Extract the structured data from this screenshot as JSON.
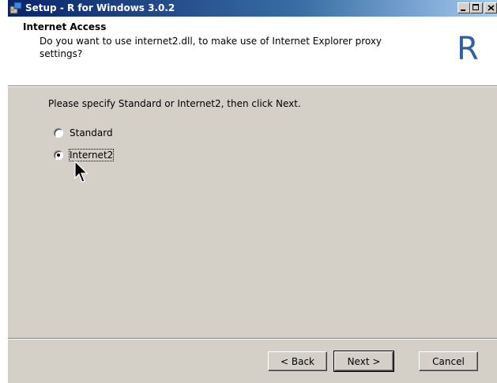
{
  "window": {
    "title": "Setup - R for Windows 3.0.2",
    "icons": [
      "app-setup-icon",
      "minimize-icon",
      "maximize-icon",
      "close-icon"
    ]
  },
  "header": {
    "title": "Internet Access",
    "description": "Do you want to use internet2.dll, to make use of Internet Explorer proxy settings?",
    "logo_text": "R"
  },
  "body": {
    "instruction": "Please specify Standard or Internet2, then click Next.",
    "options": [
      {
        "label": "Standard",
        "selected": false
      },
      {
        "label": "Internet2",
        "selected": true
      }
    ]
  },
  "buttons": {
    "back": "< Back",
    "next": "Next >",
    "cancel": "Cancel"
  },
  "colors": {
    "title_bar": "#0a246a",
    "dialog_bg": "#d4d0c8",
    "logo": "#2f5fa6"
  }
}
